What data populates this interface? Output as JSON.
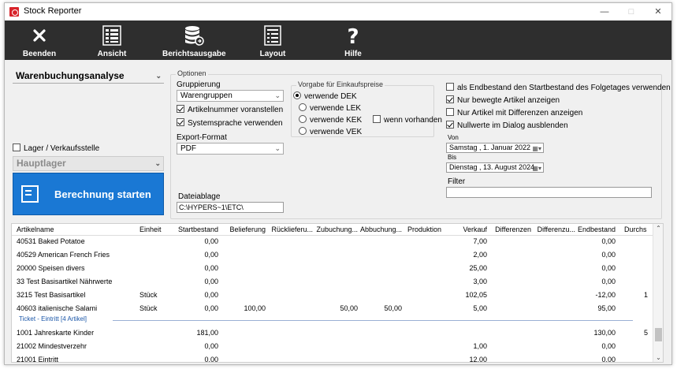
{
  "window": {
    "title": "Stock Reporter"
  },
  "toolbar": {
    "buttons": [
      {
        "label": "Beenden",
        "icon": "close-x-icon"
      },
      {
        "label": "Ansicht",
        "icon": "list-view-icon"
      },
      {
        "label": "Berichtsausgabe",
        "icon": "database-export-icon"
      },
      {
        "label": "Layout",
        "icon": "layout-list-icon"
      },
      {
        "label": "Hilfe",
        "icon": "question-mark-icon"
      }
    ]
  },
  "left": {
    "report_type": "Warenbuchungsanalyse",
    "lager_label": "Lager / Verkaufsstelle",
    "lager_value": "Hauptlager",
    "start_label": "Berechnung starten"
  },
  "options": {
    "title": "Optionen",
    "gruppierung_label": "Gruppierung",
    "gruppierung_value": "Warengruppen",
    "artikelnummer_label": "Artikelnummer voranstellen",
    "systemsprache_label": "Systemsprache verwenden",
    "exportformat_label": "Export-Format",
    "exportformat_value": "PDF",
    "dateiablage_label": "Dateiablage",
    "dateiablage_value": "C:\\HYPERS~1\\ETC\\",
    "vorgabe_title": "Vorgabe für Einkaufspreise",
    "radios": [
      "verwende DEK",
      "verwende LEK",
      "verwende KEK",
      "verwende VEK"
    ],
    "wenn_vorhanden": "wenn vorhanden",
    "right_checks": [
      "als Endbestand den Startbestand des Folgetages verwenden",
      "Nur bewegte Artikel anzeigen",
      "Nur Artikel mit Differenzen anzeigen",
      "Nullwerte im Dialog ausblenden"
    ],
    "von_label": "Von",
    "von_value": "Samstag ,   1.   Januar   2022",
    "bis_label": "Bis",
    "bis_value": "Dienstag , 13.   August   2024",
    "filter_label": "Filter"
  },
  "table": {
    "columns": [
      "Artikelname",
      "Einheit",
      "Startbestand",
      "Belieferung",
      "Rücklieferu...",
      "Zubuchung...",
      "Abbuchung...",
      "Produktion",
      "Verkauf",
      "Differenzen",
      "Differenzu...",
      "Endbestand",
      "Durchs"
    ],
    "rows": [
      {
        "name": "40531 Baked Potatoe",
        "unit": "",
        "start": "0,00",
        "bel": "",
        "rueck": "",
        "zu": "",
        "ab": "",
        "prod": "",
        "verk": "7,00",
        "diff": "",
        "diffu": "",
        "end": "0,00",
        "durch": ""
      },
      {
        "name": "40529 American French Fries",
        "unit": "",
        "start": "0,00",
        "bel": "",
        "rueck": "",
        "zu": "",
        "ab": "",
        "prod": "",
        "verk": "2,00",
        "diff": "",
        "diffu": "",
        "end": "0,00",
        "durch": ""
      },
      {
        "name": "20000 Speisen divers",
        "unit": "",
        "start": "0,00",
        "bel": "",
        "rueck": "",
        "zu": "",
        "ab": "",
        "prod": "",
        "verk": "25,00",
        "diff": "",
        "diffu": "",
        "end": "0,00",
        "durch": ""
      },
      {
        "name": "33 Test Basisartikel Nährwerte",
        "unit": "",
        "start": "0,00",
        "bel": "",
        "rueck": "",
        "zu": "",
        "ab": "",
        "prod": "",
        "verk": "3,00",
        "diff": "",
        "diffu": "",
        "end": "0,00",
        "durch": ""
      },
      {
        "name": "3215 Test Basisartikel",
        "unit": "Stück",
        "start": "0,00",
        "bel": "",
        "rueck": "",
        "zu": "",
        "ab": "",
        "prod": "",
        "verk": "102,05",
        "diff": "",
        "diffu": "",
        "end": "-12,00",
        "durch": "1"
      },
      {
        "name": "40603 italienische Salami",
        "unit": "Stück",
        "start": "0,00",
        "bel": "100,00",
        "rueck": "",
        "zu": "50,00",
        "ab": "50,00",
        "prod": "",
        "verk": "5,00",
        "diff": "",
        "diffu": "",
        "end": "95,00",
        "durch": ""
      }
    ],
    "group_label": "Ticket - Eintritt [4 Artikel]",
    "rows2": [
      {
        "name": "1001 Jahreskarte Kinder",
        "unit": "",
        "start": "181,00",
        "bel": "",
        "rueck": "",
        "zu": "",
        "ab": "",
        "prod": "",
        "verk": "",
        "diff": "",
        "diffu": "",
        "end": "130,00",
        "durch": "5"
      },
      {
        "name": "21002 Mindestverzehr",
        "unit": "",
        "start": "0,00",
        "bel": "",
        "rueck": "",
        "zu": "",
        "ab": "",
        "prod": "",
        "verk": "1,00",
        "diff": "",
        "diffu": "",
        "end": "0,00",
        "durch": ""
      },
      {
        "name": "21001 Eintritt",
        "unit": "",
        "start": "0,00",
        "bel": "",
        "rueck": "",
        "zu": "",
        "ab": "",
        "prod": "",
        "verk": "12,00",
        "diff": "",
        "diffu": "",
        "end": "0,00",
        "durch": ""
      }
    ]
  }
}
